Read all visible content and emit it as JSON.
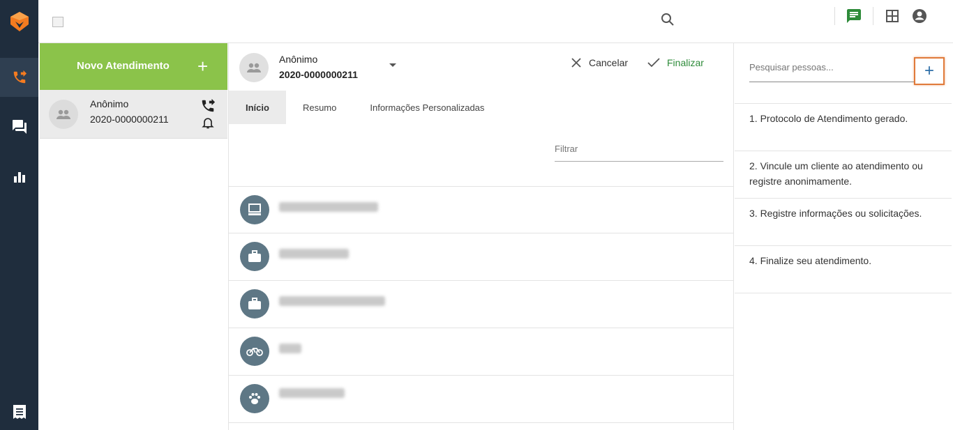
{
  "sidebar": {
    "items": [
      {
        "name": "logo",
        "icon": "fox-logo-icon"
      },
      {
        "name": "atendimentos",
        "icon": "phone-forward-icon",
        "active": true
      },
      {
        "name": "mensagens",
        "icon": "chat-icon"
      },
      {
        "name": "relatorios",
        "icon": "bar-chart-icon"
      },
      {
        "name": "notas",
        "icon": "receipt-icon"
      }
    ]
  },
  "topbar": {
    "icons": [
      "search-icon",
      "chat-icon",
      "grid-icon",
      "account-icon"
    ],
    "colors": {
      "chat": "#2e8b3a"
    }
  },
  "new_ticket": {
    "label": "Novo Atendimento",
    "plus": "+"
  },
  "ticket": {
    "name": "Anônimo",
    "protocol": "2020-0000000211"
  },
  "detail": {
    "name": "Anônimo",
    "protocol": "2020-0000000211",
    "cancel_label": "Cancelar",
    "finish_label": "Finalizar",
    "tabs": [
      {
        "label": "Início",
        "active": true
      },
      {
        "label": "Resumo"
      },
      {
        "label": "Informações Personalizadas"
      }
    ],
    "filter_placeholder": "Filtrar",
    "rows": [
      {
        "icon": "computer-icon"
      },
      {
        "icon": "briefcase-icon"
      },
      {
        "icon": "briefcase-icon"
      },
      {
        "icon": "bicycle-icon"
      },
      {
        "icon": "paw-icon"
      }
    ]
  },
  "people": {
    "search_placeholder": "Pesquisar pessoas...",
    "add_label": "+",
    "steps": [
      "1. Protocolo de Atendimento gerado.",
      "2. Vincule um cliente ao atendimento ou registre anonimamente.",
      "3. Registre informações ou solicitações.",
      "4. Finalize seu atendimento."
    ]
  },
  "colors": {
    "accent_green": "#8bc34a",
    "rail": "#1f2d3d",
    "highlight": "#e07a3a"
  }
}
